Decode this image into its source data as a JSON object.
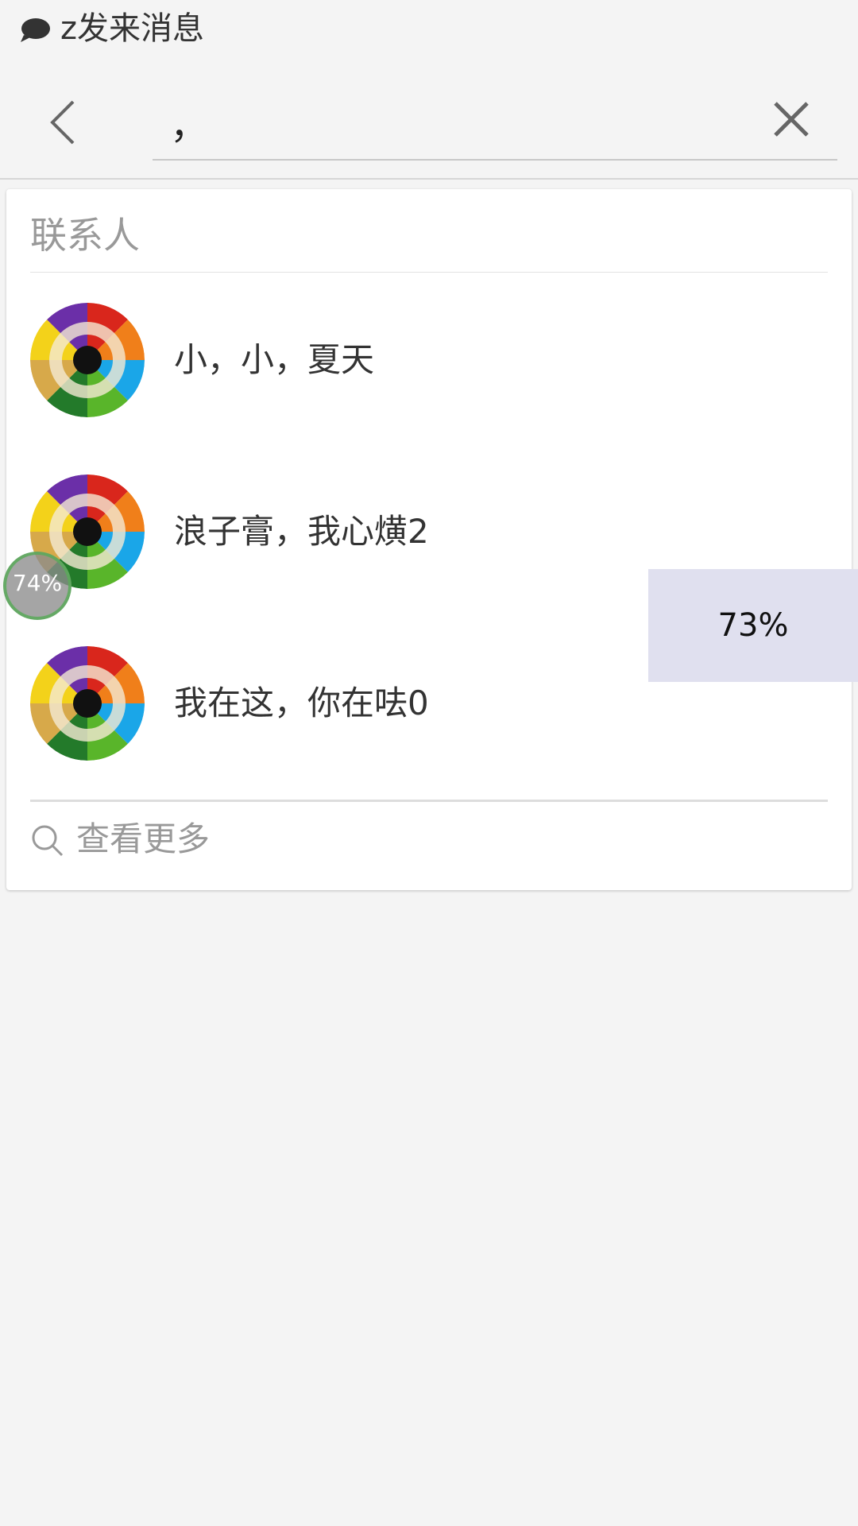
{
  "status_bar": {
    "icon": "chat-bubble-icon",
    "notification_text": "z发来消息"
  },
  "search_header": {
    "back_icon": "chevron-left-icon",
    "query": "，",
    "clear_icon": "close-icon"
  },
  "results": {
    "section_title": "联系人",
    "contacts": [
      {
        "name": "小，小，夏天",
        "avatar_icon": "colored-pencils-avatar"
      },
      {
        "name": "浪子膏，我心熿2",
        "avatar_icon": "colored-pencils-avatar"
      },
      {
        "name": "我在这，你在呿0",
        "avatar_icon": "colored-pencils-avatar"
      }
    ],
    "more_icon": "search-icon",
    "more_label": "查看更多"
  },
  "overlays": {
    "float_badge_label": "74%",
    "float_panel_label": "73%"
  },
  "colors": {
    "background": "#f4f4f4",
    "card": "#ffffff",
    "secondary_text": "#999999",
    "primary_text": "#333333",
    "panel": "#e0e0ef"
  }
}
